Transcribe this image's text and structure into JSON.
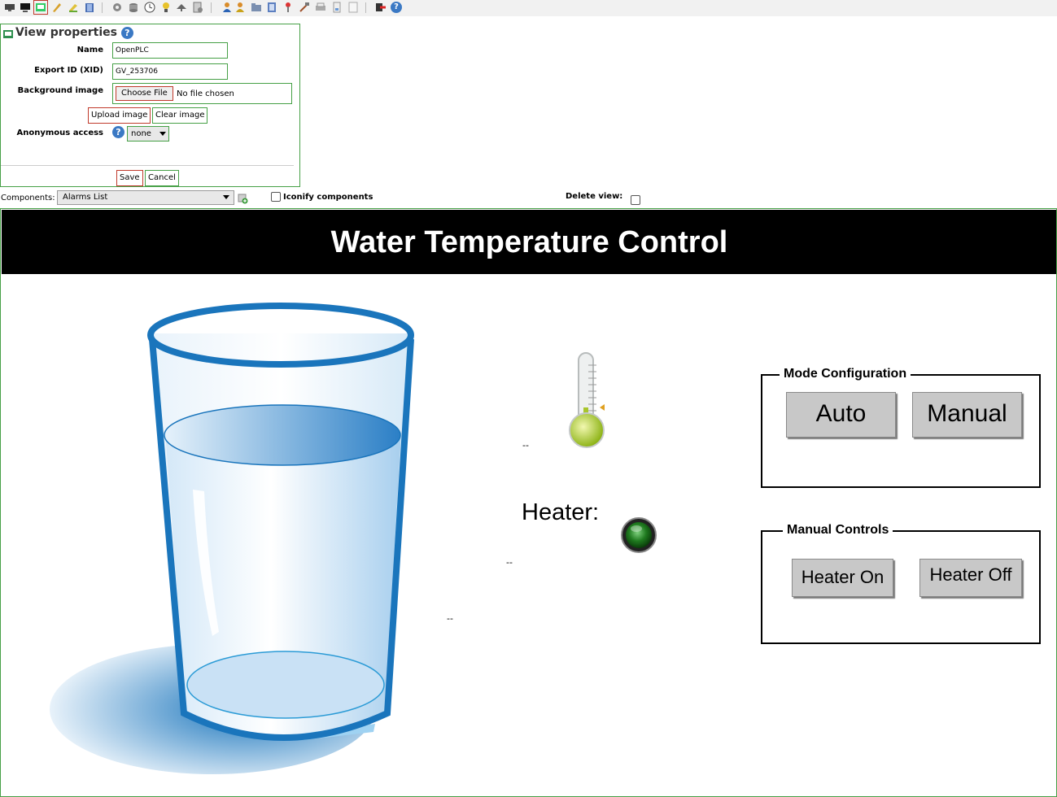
{
  "toolbar": {
    "icons": [
      "monitor-icon",
      "display-icon",
      "view-edit-icon",
      "pencil-icon",
      "edit-icon",
      "book-icon",
      "gear-icon",
      "database-icon",
      "clock-icon",
      "bulb-icon",
      "compass-icon",
      "script-icon",
      "users-icon",
      "user-lock-icon",
      "folder-icon",
      "report-icon",
      "antenna-icon",
      "hammer-icon",
      "printer-icon",
      "document-icon",
      "page-icon",
      "exit-icon",
      "help-icon"
    ]
  },
  "view_properties": {
    "title": "View properties",
    "name_label": "Name",
    "name_value": "OpenPLC",
    "xid_label": "Export ID (XID)",
    "xid_value": "GV_253706",
    "bg_label": "Background image",
    "choose_file": "Choose File",
    "no_file": "No file chosen",
    "upload_image": "Upload image",
    "clear_image": "Clear image",
    "anon_label": "Anonymous access",
    "anon_value": "none",
    "save": "Save",
    "cancel": "Cancel"
  },
  "components": {
    "label": "Components:",
    "selected": "Alarms List",
    "iconify_label": "Iconify components",
    "delete_label": "Delete view:"
  },
  "graphic_view": {
    "title": "Water Temperature Control",
    "heater_label": "Heater:",
    "value_placeholder": "--",
    "mode_box": {
      "title": "Mode Configuration",
      "auto": "Auto",
      "manual": "Manual"
    },
    "manual_box": {
      "title": "Manual Controls",
      "heater_on": "Heater On",
      "heater_off": "Heater Off"
    }
  },
  "colors": {
    "accent_green": "#46a046",
    "accent_red": "#c0392b",
    "water_blue": "#1a75bc",
    "banner": "#000000",
    "button_gray": "#c8c8c8"
  }
}
